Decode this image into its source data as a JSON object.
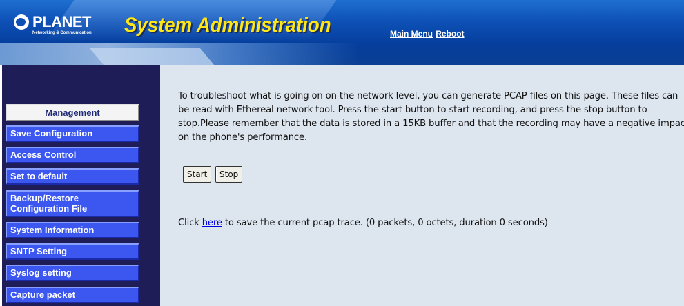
{
  "header": {
    "logo_text": "PLANET",
    "logo_tagline": "Networking & Communication",
    "title": "System Administration",
    "nav": {
      "main_menu": "Main Menu",
      "reboot": "Reboot"
    }
  },
  "sidebar": {
    "section_title": "Management",
    "items": [
      {
        "label": "Save Configuration"
      },
      {
        "label": "Access Control"
      },
      {
        "label": "Set to default"
      },
      {
        "label": "Backup/Restore Configuration File"
      },
      {
        "label": "System Information"
      },
      {
        "label": "SNTP Setting"
      },
      {
        "label": "Syslog setting"
      },
      {
        "label": "Capture packet"
      }
    ]
  },
  "main": {
    "description": "To troubleshoot what is going on on the network level, you can generate PCAP files on this page. These files can be read with Ethereal network tool. Press the start button to start recording, and press the stop button to stop.Please remember that the data is stored in a 15KB buffer and that the recording may have a negative impact on the phone's performance.",
    "start_label": "Start",
    "stop_label": "Stop",
    "save_prefix": "Click ",
    "save_link": "here",
    "save_suffix": " to save the current pcap trace. (0 packets, 0 octets, duration 0 seconds)"
  },
  "colors": {
    "banner": "#0d4fb4",
    "title_yellow": "#ffe617",
    "sidebar_bg": "#1e1d57",
    "menu_button": "#3b57f0",
    "content_bg": "#dde5ee",
    "link": "#0000dd"
  },
  "icons": {
    "logo": "planet-logo-icon"
  }
}
